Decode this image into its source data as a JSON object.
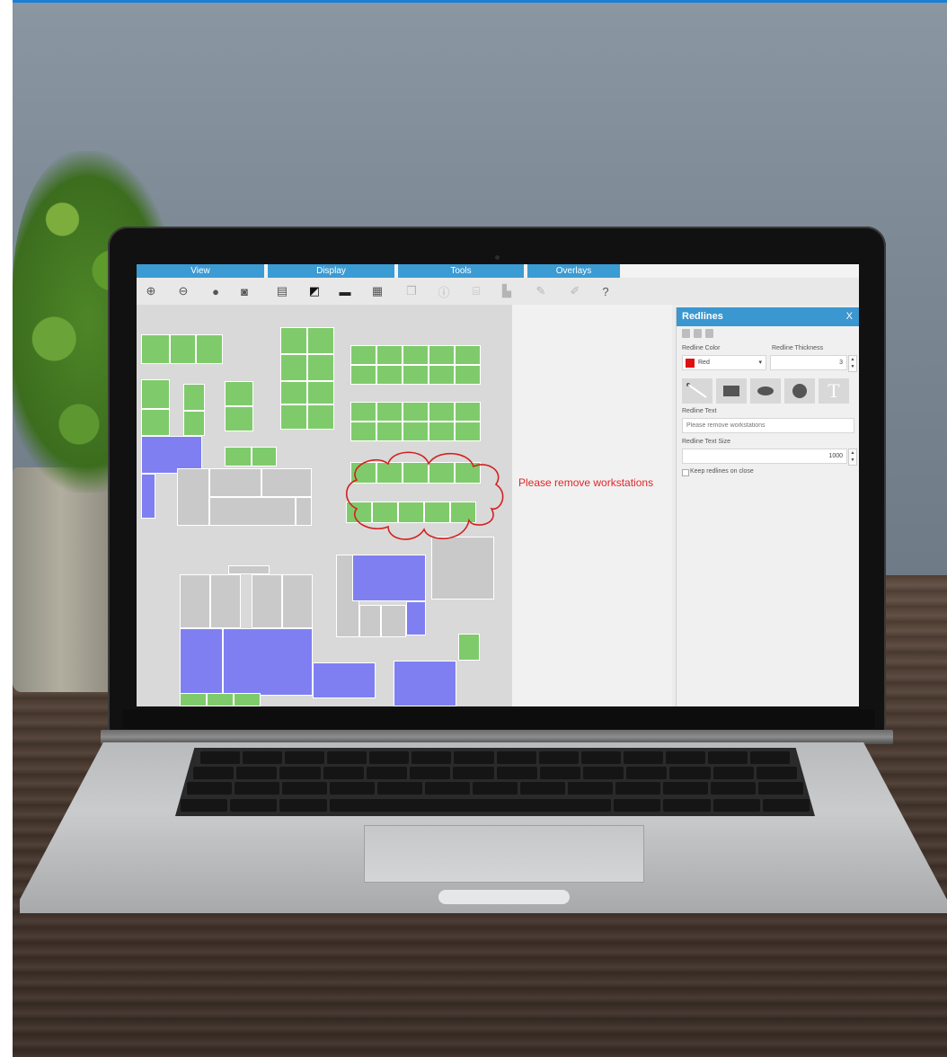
{
  "app": {
    "tab_groups": [
      "View",
      "Display",
      "Tools",
      "Overlays"
    ]
  },
  "toolbar": {
    "view_tools": [
      "zoom-in-icon",
      "zoom-out-icon",
      "zoom-extents-icon",
      "zoom-window-icon"
    ],
    "display_tools": [
      "layers-icon",
      "fill-icon",
      "gradient-icon",
      "tiles-icon"
    ],
    "tools_tools": [
      "copy-icon",
      "info-icon",
      "measure-icon",
      "report-icon"
    ],
    "overlay_tools": [
      "pencil-icon",
      "marker-icon",
      "help-icon"
    ]
  },
  "floorplan": {
    "annotation_text": "Please remove workstations",
    "annotation_color": "#e0262a",
    "room_colors": {
      "assigned": "#7fcb6c",
      "vacant": "#7f7ff2",
      "common": "#c9c9c9"
    }
  },
  "redlines": {
    "title": "Redlines",
    "close": "X",
    "color_label": "Redline Color",
    "color_value": "Red",
    "color_swatch": "#e01010",
    "thickness_label": "Redline Thickness",
    "thickness_value": "3",
    "shapes": [
      "line-icon",
      "rectangle-icon",
      "ellipse-icon",
      "cloud-icon",
      "text-icon"
    ],
    "text_label": "Redline Text",
    "text_placeholder": "Please remove workstations",
    "text_size_label": "Redline Text Size",
    "text_size_value": "1000",
    "keep_label": "Keep redlines on close"
  }
}
